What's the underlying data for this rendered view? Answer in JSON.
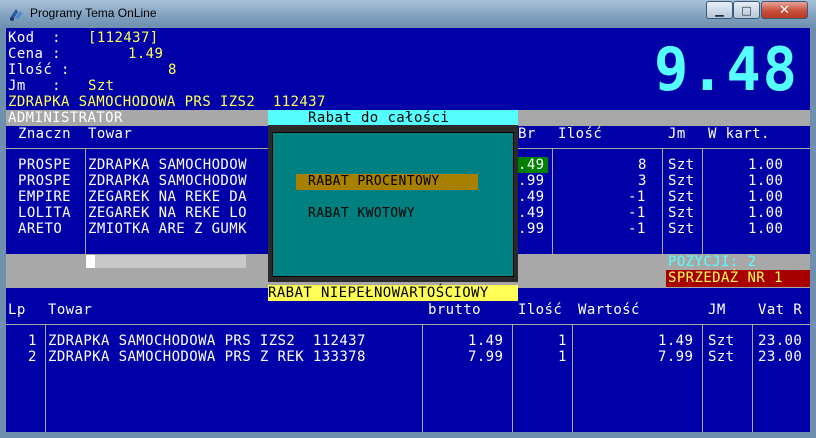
{
  "window": {
    "title": "Programy Tema OnLine"
  },
  "info": {
    "kod_label": "Kod  :",
    "kod_value": "[112437]",
    "cena_label": "Cena :",
    "cena_value": "1.49",
    "ilosc_label": "Ilość :",
    "ilosc_value": "8",
    "jm_label": "Jm   :",
    "jm_value": "Szt",
    "product_name": "ZDRAPKA SAMOCHODOWA PRS IZS2  112437",
    "user": "ADMINISTRATOR"
  },
  "total": "9.48",
  "upper_table": {
    "headers": {
      "znaczn": "Znaczn",
      "towar": "Towar",
      "br": "Br",
      "ilosc": "Ilość",
      "jm": "Jm",
      "wkart": "W kart."
    },
    "rows": [
      {
        "znaczn": "PROSPE",
        "towar": "ZDRAPKA SAMOCHODOW",
        "br": ".49",
        "ilosc": "8",
        "jm": "Szt",
        "wkart": "1.00"
      },
      {
        "znaczn": "PROSPE",
        "towar": "ZDRAPKA SAMOCHODOW",
        "br": ".99",
        "ilosc": "3",
        "jm": "Szt",
        "wkart": "1.00"
      },
      {
        "znaczn": "EMPIRE",
        "towar": "ZEGAREK NA REKE DA",
        "br": ".49",
        "ilosc": "-1",
        "jm": "Szt",
        "wkart": "1.00"
      },
      {
        "znaczn": "LOLITA",
        "towar": "ZEGAREK NA REKE LO",
        "br": ".49",
        "ilosc": "-1",
        "jm": "Szt",
        "wkart": "1.00"
      },
      {
        "znaczn": "ARETO",
        "towar": "ZMIOTKA ARE Z GUMK",
        "br": ".99",
        "ilosc": "-1",
        "jm": "Szt",
        "wkart": "1.00"
      }
    ]
  },
  "status": {
    "pozycji": "POZYCJI: 2",
    "sprzedaz": "SPRZEDAŻ NR 1"
  },
  "dialog": {
    "title": "Rabat do całości",
    "options": [
      "RABAT PROCENTOWY",
      "RABAT KWOTOWY"
    ],
    "footer": "RABAT NIEPEŁNOWARTOŚCIOWY"
  },
  "lower_table": {
    "headers": {
      "lp": "Lp",
      "towar": "Towar",
      "brutto": "brutto",
      "ilosc": "Ilość",
      "wartosc": "Wartość",
      "jm": "JM",
      "vat": "Vat R"
    },
    "rows": [
      {
        "lp": "1",
        "towar": "ZDRAPKA SAMOCHODOWA PRS IZS2  112437",
        "brutto": "1.49",
        "ilosc": "1",
        "wartosc": "1.49",
        "jm": "Szt",
        "vat": "23.00"
      },
      {
        "lp": "2",
        "towar": "ZDRAPKA SAMOCHODOWA PRS Z REK 133378",
        "brutto": "7.99",
        "ilosc": "1",
        "wartosc": "7.99",
        "jm": "Szt",
        "vat": "23.00"
      }
    ]
  },
  "colors": {
    "console_bg": "#0000a8",
    "yellow": "#ffff55",
    "cyan": "#55ffff",
    "teal": "#008080",
    "red": "#a80000"
  }
}
